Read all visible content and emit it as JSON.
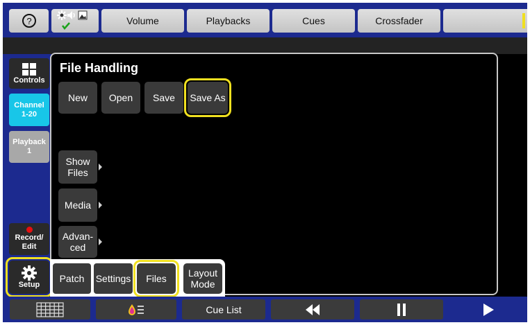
{
  "topbar": {
    "help_icon": "question-mark-icon",
    "status_icons": [
      "sun-icon",
      "speaker-icon",
      "picture-icon",
      "checkmark-icon"
    ],
    "tabs": [
      "Volume",
      "Playbacks",
      "Cues",
      "Crossfader"
    ]
  },
  "leftcol": {
    "controls_label": "Controls",
    "channel_label": "Channel 1-20",
    "playback_label": "Playback 1",
    "record_label": "Record/ Edit",
    "setup_label": "Setup"
  },
  "panel": {
    "title": "File Handling",
    "file_buttons": [
      "New",
      "Open",
      "Save",
      "Save As"
    ],
    "side_buttons": [
      "Show Files",
      "Media",
      "Advan- ced"
    ],
    "bottom_tabs": [
      "Patch",
      "Settings",
      "Files",
      "Layout Mode"
    ]
  },
  "bottombar": {
    "cue_list_label": "Cue List"
  },
  "colors": {
    "bar_blue": "#1c2a8f",
    "highlight_yellow": "#f0e020",
    "channel_cyan": "#18c6e8"
  }
}
